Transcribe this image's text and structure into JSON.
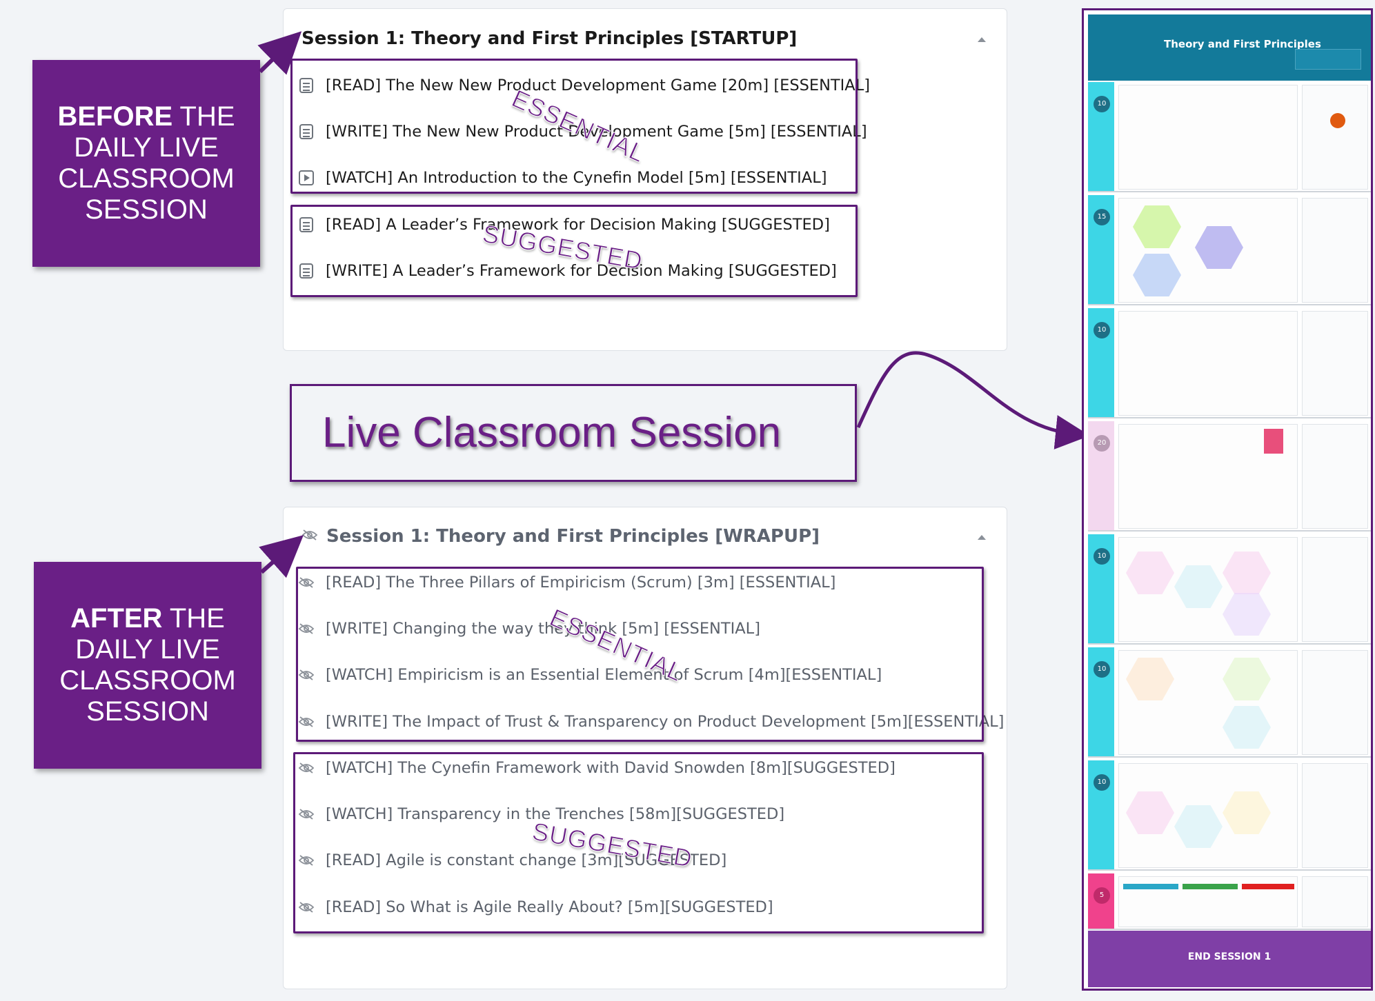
{
  "startup": {
    "title": "Session 1: Theory and First Principles [STARTUP]",
    "lessons": [
      {
        "icon": "document-icon",
        "label": "[READ] The New New Product Development Game [20m] [ESSENTIAL]"
      },
      {
        "icon": "document-icon",
        "label": "[WRITE] The New New Product Development Game [5m] [ESSENTIAL]"
      },
      {
        "icon": "play-icon",
        "label": "[WATCH] An Introduction to the Cynefin Model [5m] [ESSENTIAL]"
      },
      {
        "icon": "document-icon",
        "label": "[READ] A Leader’s Framework for Decision Making [SUGGESTED]"
      },
      {
        "icon": "document-icon",
        "label": "[WRITE] A Leader’s Framework for Decision Making [SUGGESTED]"
      }
    ]
  },
  "wrapup": {
    "title": "Session 1: Theory and First Principles [WRAPUP]",
    "lessons": [
      {
        "icon": "hidden-icon",
        "label": "[READ] The Three Pillars of Empiricism (Scrum) [3m] [ESSENTIAL]"
      },
      {
        "icon": "hidden-icon",
        "label": "[WRITE] Changing the way they think [5m] [ESSENTIAL]"
      },
      {
        "icon": "hidden-icon",
        "label": "[WATCH] Empiricism is an Essential Element of Scrum [4m][ESSENTIAL]"
      },
      {
        "icon": "hidden-icon",
        "label": "[WRITE] The Impact of Trust & Transparency on Product Development [5m][ESSENTIAL]"
      },
      {
        "icon": "hidden-icon",
        "label": "[WATCH] The Cynefin Framework with David Snowden [8m][SUGGESTED]"
      },
      {
        "icon": "hidden-icon",
        "label": "[WATCH] Transparency in the Trenches [58m][SUGGESTED]"
      },
      {
        "icon": "hidden-icon",
        "label": "[READ] Agile is constant change [3m][SUGGESTED]"
      },
      {
        "icon": "hidden-icon",
        "label": "[READ] So What is Agile Really About? [5m][SUGGESTED]"
      }
    ]
  },
  "callouts": {
    "before": {
      "bold": "BEFORE",
      "line1_rest": " THE",
      "line2": "DAILY LIVE",
      "line3": "CLASSROOM",
      "line4": "SESSION"
    },
    "after": {
      "bold": "AFTER",
      "line1_rest": " THE",
      "line2": "DAILY LIVE",
      "line3": "CLASSROOM",
      "line4": "SESSION"
    },
    "live": "Live Classroom Session"
  },
  "stamps": {
    "essential": "ESSENTIAL",
    "suggested": "SUGGESTED"
  },
  "board": {
    "title": "Theory and First Principles",
    "footer": "END SESSION 1",
    "row_badges": [
      "10",
      "15",
      "10",
      "20",
      "10",
      "10",
      "10",
      "5"
    ]
  },
  "colors": {
    "accent_purple": "#6a1f86",
    "board_header": "#137a9a",
    "board_strip": "#3dd6e6",
    "board_footer": "#7f3fa6"
  }
}
